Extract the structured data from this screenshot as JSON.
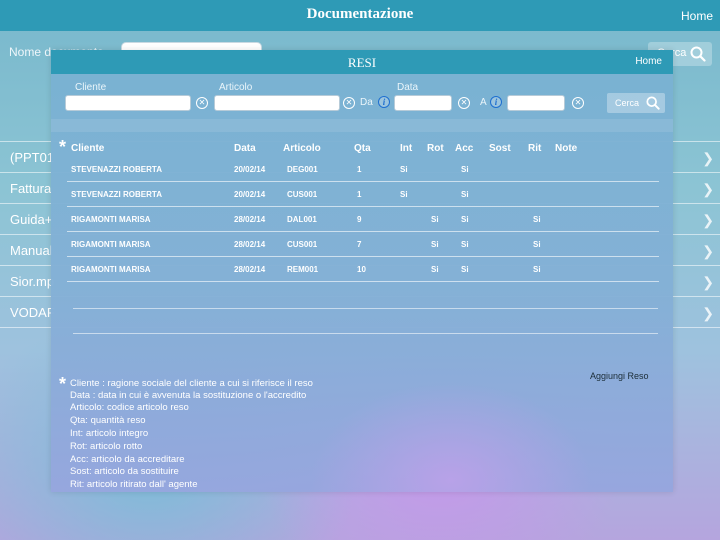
{
  "background": {
    "title": "Documentazione",
    "home": "Home",
    "search_label": "Nome documento",
    "search_button": "Cerca",
    "files": [
      "(PPT01",
      "Fattura",
      "Guida+",
      "Manual",
      "Sior.mp",
      "VODAF"
    ]
  },
  "modal": {
    "title": "RESI",
    "home": "Home",
    "filters": {
      "cliente_label": "Cliente",
      "articolo_label": "Articolo",
      "data_label": "Data",
      "da_label": "Da",
      "a_label": "A",
      "search_button": "Cerca"
    },
    "asterisk": "*",
    "table": {
      "headers": [
        "Cliente",
        "Data",
        "Articolo",
        "Qta",
        "Int",
        "Rot",
        "Acc",
        "Sost",
        "Rit",
        "Note"
      ],
      "rows": [
        [
          "STEVENAZZI ROBERTA",
          "20/02/14",
          "DEG001",
          "1",
          "Si",
          "",
          "Si",
          "",
          "",
          ""
        ],
        [
          "STEVENAZZI ROBERTA",
          "20/02/14",
          "CUS001",
          "1",
          "Si",
          "",
          "Si",
          "",
          "",
          ""
        ],
        [
          "RIGAMONTI MARISA",
          "28/02/14",
          "DAL001",
          "9",
          "",
          "Si",
          "Si",
          "",
          "Si",
          ""
        ],
        [
          "RIGAMONTI MARISA",
          "28/02/14",
          "CUS001",
          "7",
          "",
          "Si",
          "Si",
          "",
          "Si",
          ""
        ],
        [
          "RIGAMONTI MARISA",
          "28/02/14",
          "REM001",
          "10",
          "",
          "Si",
          "Si",
          "",
          "Si",
          ""
        ]
      ]
    },
    "add_button": "Aggiungi Reso",
    "legend": [
      "Cliente : ragione sociale del cliente a cui si riferisce il reso",
      "Data : data in cui è avvenuta la sostituzione o l'accredito",
      "Articolo: codice articolo reso",
      "Qta: quantità reso",
      "Int: articolo integro",
      "Rot: articolo rotto",
      "Acc: articolo da accreditare",
      "Sost: articolo da sostituire",
      "Rit: articolo ritirato dall' agente"
    ]
  },
  "colors": {
    "header_bar": "#2e9ab6",
    "info_icon": "#1e6fd0"
  }
}
